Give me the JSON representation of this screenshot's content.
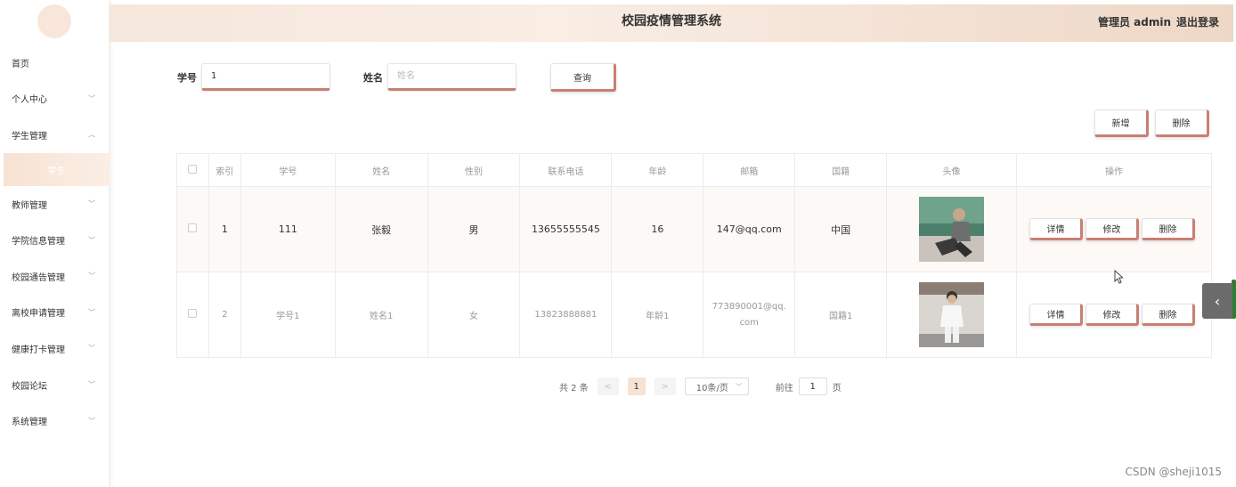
{
  "header": {
    "title": "校园疫情管理系统",
    "user": "管理员 admin",
    "logout": "退出登录"
  },
  "sidebar": {
    "items": [
      {
        "label": "首页",
        "chev": ""
      },
      {
        "label": "个人中心",
        "chev": "﹀"
      },
      {
        "label": "学生管理",
        "chev": "︿"
      },
      {
        "label": "学生",
        "chev": ""
      },
      {
        "label": "教师管理",
        "chev": "﹀"
      },
      {
        "label": "学院信息管理",
        "chev": "﹀"
      },
      {
        "label": "校园通告管理",
        "chev": "﹀"
      },
      {
        "label": "离校申请管理",
        "chev": "﹀"
      },
      {
        "label": "健康打卡管理",
        "chev": "﹀"
      },
      {
        "label": "校园论坛",
        "chev": "﹀"
      },
      {
        "label": "系统管理",
        "chev": "﹀"
      }
    ]
  },
  "search": {
    "id_label": "学号",
    "id_value": "1",
    "name_label": "姓名",
    "name_placeholder": "姓名",
    "query_button": "查询"
  },
  "actions": {
    "add": "新增",
    "delete": "删除"
  },
  "table": {
    "headers": [
      "",
      "索引",
      "学号",
      "姓名",
      "性别",
      "联系电话",
      "年龄",
      "邮箱",
      "国籍",
      "头像",
      "操作"
    ],
    "rows": [
      {
        "index": "1",
        "id": "111",
        "name": "张毅",
        "gender": "男",
        "phone": "13655555545",
        "age": "16",
        "email": "147@qq.com",
        "country": "中国"
      },
      {
        "index": "2",
        "id": "学号1",
        "name": "姓名1",
        "gender": "女",
        "phone": "13823888881",
        "age": "年龄1",
        "email": "773890001@qq.com",
        "country": "国籍1"
      }
    ],
    "row_ops": {
      "detail": "详情",
      "edit": "修改",
      "delete": "删除"
    }
  },
  "pagination": {
    "total": "共 2 条",
    "prev": "<",
    "current": "1",
    "next": ">",
    "page_size": "10条/页",
    "goto_label": "前往",
    "goto_value": "1",
    "page_suffix": "页"
  },
  "watermark": "CSDN @sheji1015",
  "colors": {
    "accent": "#c97f74",
    "header_bg": "#f6e7dc",
    "active_menu": "#f7e2d3"
  }
}
